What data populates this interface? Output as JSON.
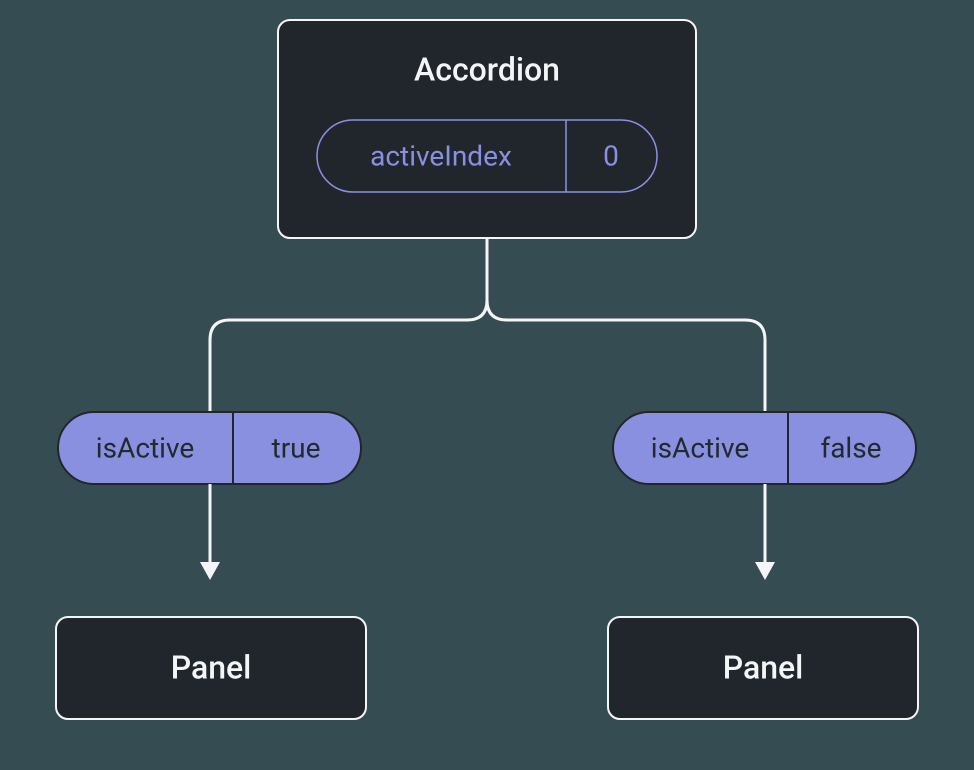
{
  "accordion": {
    "title": "Accordion",
    "state": {
      "label": "activeIndex",
      "value": "0"
    }
  },
  "props": {
    "left": {
      "label": "isActive",
      "value": "true"
    },
    "right": {
      "label": "isActive",
      "value": "false"
    }
  },
  "panels": {
    "left": {
      "title": "Panel"
    },
    "right": {
      "title": "Panel"
    }
  },
  "colors": {
    "background": "#354C53",
    "card_bg": "#21262D",
    "stroke": "#F4F5F6",
    "accent": "#8A90E0",
    "accent_text": "#22292F"
  }
}
